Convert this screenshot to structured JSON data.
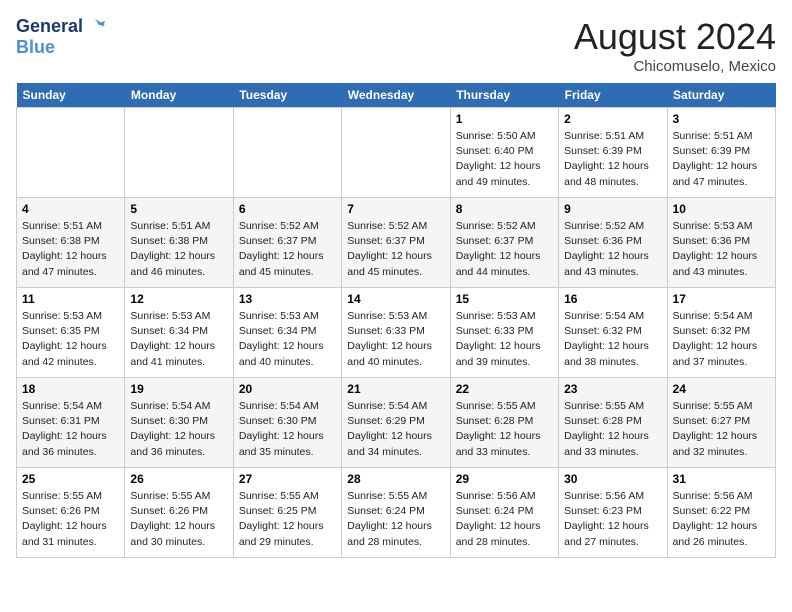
{
  "header": {
    "logo_line1": "General",
    "logo_line2": "Blue",
    "month_title": "August 2024",
    "location": "Chicomuselo, Mexico"
  },
  "days_of_week": [
    "Sunday",
    "Monday",
    "Tuesday",
    "Wednesday",
    "Thursday",
    "Friday",
    "Saturday"
  ],
  "weeks": [
    [
      {
        "day": "",
        "info": ""
      },
      {
        "day": "",
        "info": ""
      },
      {
        "day": "",
        "info": ""
      },
      {
        "day": "",
        "info": ""
      },
      {
        "day": "1",
        "info": "Sunrise: 5:50 AM\nSunset: 6:40 PM\nDaylight: 12 hours\nand 49 minutes."
      },
      {
        "day": "2",
        "info": "Sunrise: 5:51 AM\nSunset: 6:39 PM\nDaylight: 12 hours\nand 48 minutes."
      },
      {
        "day": "3",
        "info": "Sunrise: 5:51 AM\nSunset: 6:39 PM\nDaylight: 12 hours\nand 47 minutes."
      }
    ],
    [
      {
        "day": "4",
        "info": "Sunrise: 5:51 AM\nSunset: 6:38 PM\nDaylight: 12 hours\nand 47 minutes."
      },
      {
        "day": "5",
        "info": "Sunrise: 5:51 AM\nSunset: 6:38 PM\nDaylight: 12 hours\nand 46 minutes."
      },
      {
        "day": "6",
        "info": "Sunrise: 5:52 AM\nSunset: 6:37 PM\nDaylight: 12 hours\nand 45 minutes."
      },
      {
        "day": "7",
        "info": "Sunrise: 5:52 AM\nSunset: 6:37 PM\nDaylight: 12 hours\nand 45 minutes."
      },
      {
        "day": "8",
        "info": "Sunrise: 5:52 AM\nSunset: 6:37 PM\nDaylight: 12 hours\nand 44 minutes."
      },
      {
        "day": "9",
        "info": "Sunrise: 5:52 AM\nSunset: 6:36 PM\nDaylight: 12 hours\nand 43 minutes."
      },
      {
        "day": "10",
        "info": "Sunrise: 5:53 AM\nSunset: 6:36 PM\nDaylight: 12 hours\nand 43 minutes."
      }
    ],
    [
      {
        "day": "11",
        "info": "Sunrise: 5:53 AM\nSunset: 6:35 PM\nDaylight: 12 hours\nand 42 minutes."
      },
      {
        "day": "12",
        "info": "Sunrise: 5:53 AM\nSunset: 6:34 PM\nDaylight: 12 hours\nand 41 minutes."
      },
      {
        "day": "13",
        "info": "Sunrise: 5:53 AM\nSunset: 6:34 PM\nDaylight: 12 hours\nand 40 minutes."
      },
      {
        "day": "14",
        "info": "Sunrise: 5:53 AM\nSunset: 6:33 PM\nDaylight: 12 hours\nand 40 minutes."
      },
      {
        "day": "15",
        "info": "Sunrise: 5:53 AM\nSunset: 6:33 PM\nDaylight: 12 hours\nand 39 minutes."
      },
      {
        "day": "16",
        "info": "Sunrise: 5:54 AM\nSunset: 6:32 PM\nDaylight: 12 hours\nand 38 minutes."
      },
      {
        "day": "17",
        "info": "Sunrise: 5:54 AM\nSunset: 6:32 PM\nDaylight: 12 hours\nand 37 minutes."
      }
    ],
    [
      {
        "day": "18",
        "info": "Sunrise: 5:54 AM\nSunset: 6:31 PM\nDaylight: 12 hours\nand 36 minutes."
      },
      {
        "day": "19",
        "info": "Sunrise: 5:54 AM\nSunset: 6:30 PM\nDaylight: 12 hours\nand 36 minutes."
      },
      {
        "day": "20",
        "info": "Sunrise: 5:54 AM\nSunset: 6:30 PM\nDaylight: 12 hours\nand 35 minutes."
      },
      {
        "day": "21",
        "info": "Sunrise: 5:54 AM\nSunset: 6:29 PM\nDaylight: 12 hours\nand 34 minutes."
      },
      {
        "day": "22",
        "info": "Sunrise: 5:55 AM\nSunset: 6:28 PM\nDaylight: 12 hours\nand 33 minutes."
      },
      {
        "day": "23",
        "info": "Sunrise: 5:55 AM\nSunset: 6:28 PM\nDaylight: 12 hours\nand 33 minutes."
      },
      {
        "day": "24",
        "info": "Sunrise: 5:55 AM\nSunset: 6:27 PM\nDaylight: 12 hours\nand 32 minutes."
      }
    ],
    [
      {
        "day": "25",
        "info": "Sunrise: 5:55 AM\nSunset: 6:26 PM\nDaylight: 12 hours\nand 31 minutes."
      },
      {
        "day": "26",
        "info": "Sunrise: 5:55 AM\nSunset: 6:26 PM\nDaylight: 12 hours\nand 30 minutes."
      },
      {
        "day": "27",
        "info": "Sunrise: 5:55 AM\nSunset: 6:25 PM\nDaylight: 12 hours\nand 29 minutes."
      },
      {
        "day": "28",
        "info": "Sunrise: 5:55 AM\nSunset: 6:24 PM\nDaylight: 12 hours\nand 28 minutes."
      },
      {
        "day": "29",
        "info": "Sunrise: 5:56 AM\nSunset: 6:24 PM\nDaylight: 12 hours\nand 28 minutes."
      },
      {
        "day": "30",
        "info": "Sunrise: 5:56 AM\nSunset: 6:23 PM\nDaylight: 12 hours\nand 27 minutes."
      },
      {
        "day": "31",
        "info": "Sunrise: 5:56 AM\nSunset: 6:22 PM\nDaylight: 12 hours\nand 26 minutes."
      }
    ]
  ]
}
